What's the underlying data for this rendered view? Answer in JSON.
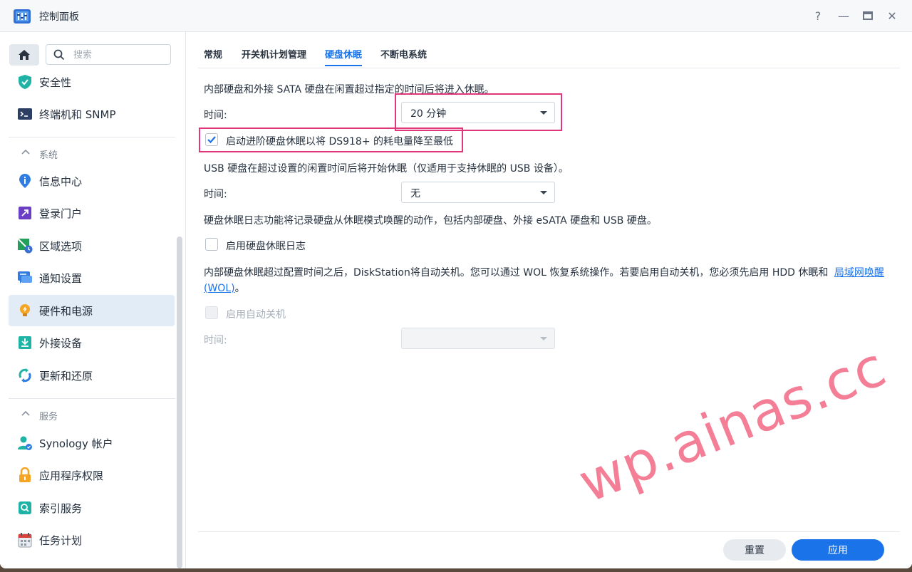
{
  "window": {
    "title": "控制面板",
    "controls": {
      "help": "?",
      "minimize": "—",
      "maximize": "▭",
      "close": "✕"
    }
  },
  "sidebar": {
    "search_placeholder": "搜索",
    "items_top": [
      {
        "label": "安全性",
        "icon": "shield-icon"
      },
      {
        "label": "终端机和 SNMP",
        "icon": "terminal-icon"
      }
    ],
    "section_system": "系统",
    "items_system": [
      {
        "label": "信息中心",
        "icon": "info-icon"
      },
      {
        "label": "登录门户",
        "icon": "portal-icon"
      },
      {
        "label": "区域选项",
        "icon": "region-icon"
      },
      {
        "label": "通知设置",
        "icon": "notification-icon"
      },
      {
        "label": "硬件和电源",
        "icon": "bulb-icon",
        "active": true
      },
      {
        "label": "外接设备",
        "icon": "external-device-icon"
      },
      {
        "label": "更新和还原",
        "icon": "update-icon"
      }
    ],
    "section_services": "服务",
    "items_services": [
      {
        "label": "Synology 帐户",
        "icon": "account-icon"
      },
      {
        "label": "应用程序权限",
        "icon": "lock-icon"
      },
      {
        "label": "索引服务",
        "icon": "index-icon"
      },
      {
        "label": "任务计划",
        "icon": "calendar-icon"
      }
    ]
  },
  "tabs": [
    "常规",
    "开关机计划管理",
    "硬盘休眠",
    "不断电系统"
  ],
  "active_tab": "硬盘休眠",
  "content": {
    "desc_internal": "内部硬盘和外接 SATA 硬盘在闲置超过指定的时间后将进入休眠。",
    "time_label": "时间:",
    "internal_time_value": "20 分钟",
    "advanced_hibernation_label": "启动进阶硬盘休眠以将 DS918+ 的耗电量降至最低",
    "advanced_hibernation_checked": true,
    "desc_usb": "USB 硬盘在超过设置的闲置时间后将开始休眠（仅适用于支持休眠的 USB 设备）。",
    "usb_time_value": "无",
    "desc_log": "硬盘休眠日志功能将记录硬盘从休眠模式唤醒的动作，包括内部硬盘、外接 eSATA 硬盘和 USB 硬盘。",
    "enable_log_label": "启用硬盘休眠日志",
    "enable_log_checked": false,
    "desc_shutdown": "内部硬盘休眠超过配置时间之后，DiskStation将自动关机。您可以通过 WOL 恢复系统操作。若要启用自动关机，您必须先启用 HDD 休眠和",
    "wol_link_part1": "局域网唤醒",
    "wol_link_part2": "(WOL)",
    "desc_shutdown_end": "。",
    "enable_shutdown_label": "启用自动关机",
    "shutdown_time_value": ""
  },
  "footer": {
    "reset": "重置",
    "apply": "应用"
  },
  "watermark": "wp.ainas.cc",
  "colors": {
    "accent": "#1a73e8",
    "highlight": "#e0377a",
    "active_bg": "#e2ecf7"
  }
}
